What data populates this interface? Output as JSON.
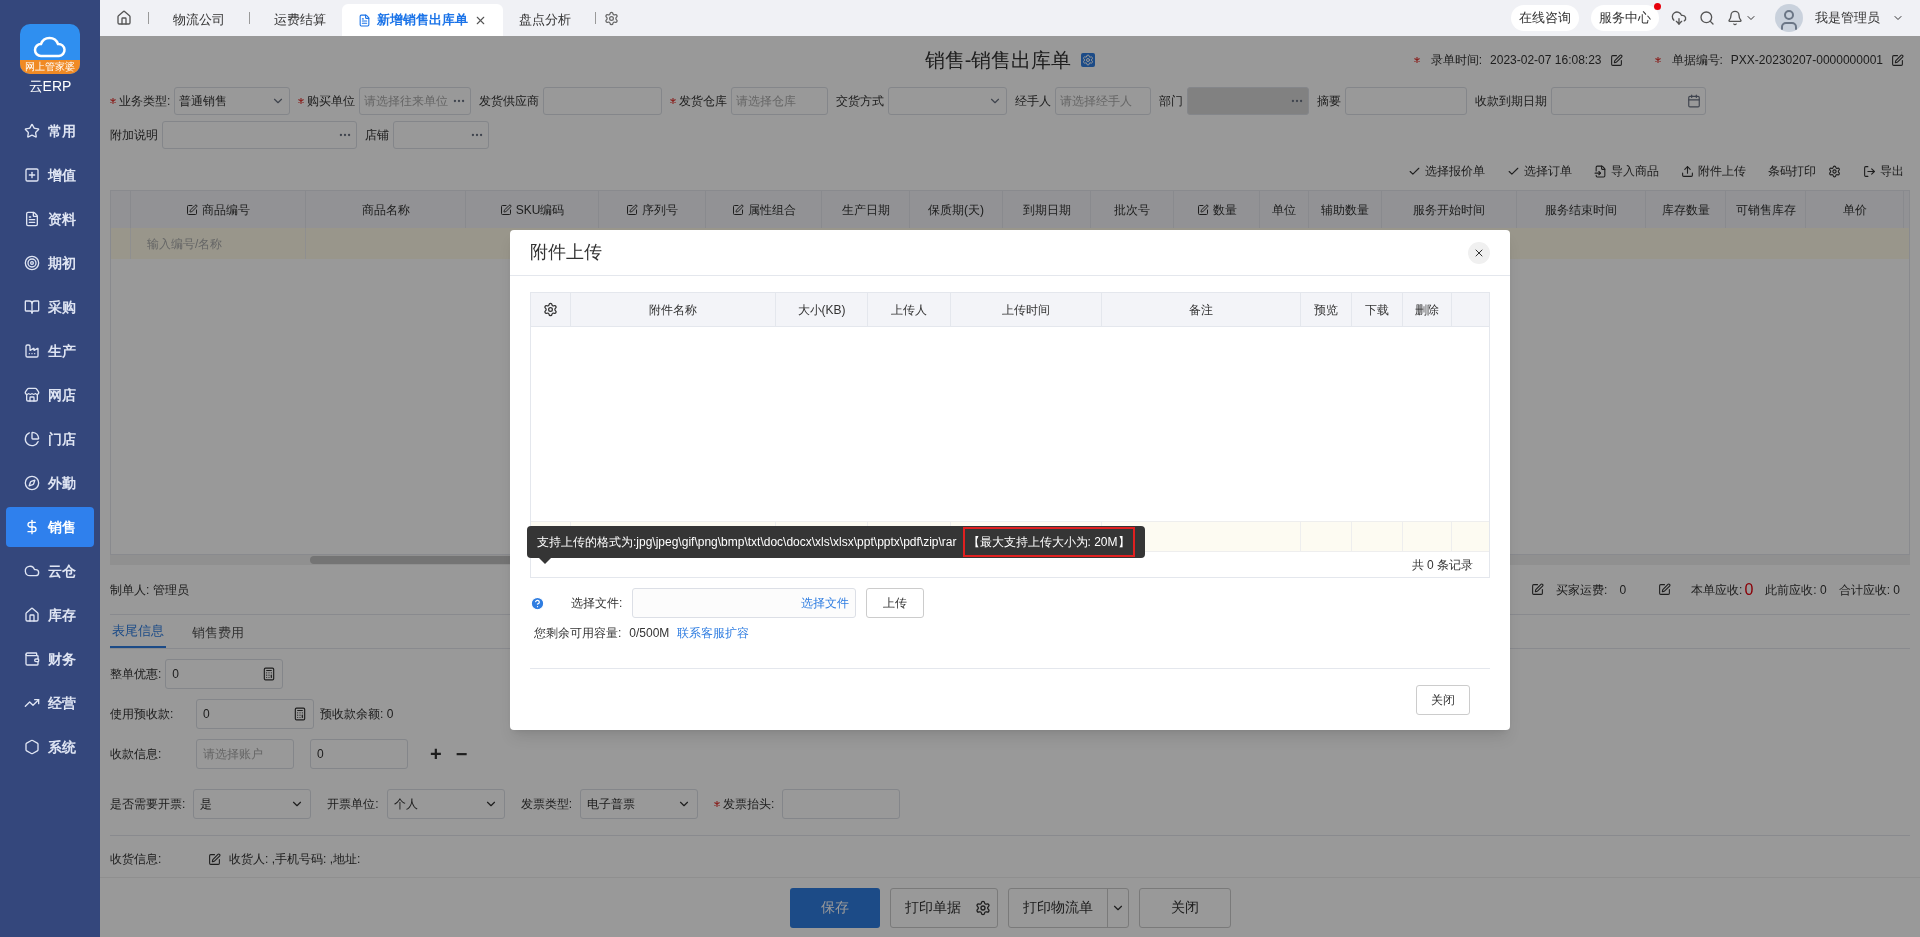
{
  "sidebar": {
    "logo_badge": "网上管家婆",
    "app_name": "云ERP",
    "items": [
      {
        "label": "常用",
        "selected": false
      },
      {
        "label": "增值",
        "selected": false
      },
      {
        "label": "资料",
        "selected": false
      },
      {
        "label": "期初",
        "selected": false
      },
      {
        "label": "采购",
        "selected": false
      },
      {
        "label": "生产",
        "selected": false
      },
      {
        "label": "网店",
        "selected": false
      },
      {
        "label": "门店",
        "selected": false
      },
      {
        "label": "外勤",
        "selected": false
      },
      {
        "label": "销售",
        "selected": true
      },
      {
        "label": "云仓",
        "selected": false
      },
      {
        "label": "库存",
        "selected": false
      },
      {
        "label": "财务",
        "selected": false
      },
      {
        "label": "经营",
        "selected": false
      },
      {
        "label": "系统",
        "selected": false
      }
    ]
  },
  "tabs": [
    {
      "label": "物流公司",
      "selected": false
    },
    {
      "label": "运费结算",
      "selected": false
    },
    {
      "label": "新增销售出库单",
      "selected": true
    },
    {
      "label": "盘点分析",
      "selected": false
    }
  ],
  "top_right": {
    "consult": "在线咨询",
    "service": "服务中心",
    "service_badge": true,
    "user": "我是管理员"
  },
  "form": {
    "title": "销售-销售出库单",
    "entry_time": {
      "label": "录单时间:",
      "required": true,
      "value": "2023-02-07 16:08:23"
    },
    "doc_no": {
      "label": "单据编号:",
      "required": true,
      "value": "PXX-20230207-0000000001"
    },
    "fields": [
      {
        "label": "业务类型:",
        "required": true,
        "value": "普通销售",
        "kind": "select",
        "disabled": false
      },
      {
        "label": "购买单位",
        "required": true,
        "placeholder": "请选择往来单位",
        "kind": "dots",
        "disabled": false
      },
      {
        "label": "发货供应商",
        "required": false,
        "kind": "text",
        "disabled": false
      },
      {
        "label": "发货仓库",
        "required": true,
        "placeholder": "请选择仓库",
        "kind": "text",
        "disabled": false
      },
      {
        "label": "交货方式",
        "required": false,
        "kind": "select",
        "disabled": false
      },
      {
        "label": "经手人",
        "required": false,
        "placeholder": "请选择经手人",
        "kind": "text",
        "disabled": false
      },
      {
        "label": "部门",
        "required": false,
        "kind": "dots",
        "disabled": true
      },
      {
        "label": "摘要",
        "required": false,
        "kind": "text",
        "disabled": false
      },
      {
        "label": "收款到期日期",
        "required": false,
        "kind": "date",
        "disabled": false
      }
    ],
    "fields_2": [
      {
        "label": "附加说明",
        "required": false,
        "kind": "dots",
        "disabled": false
      },
      {
        "label": "店铺",
        "required": false,
        "kind": "dots",
        "disabled": false
      }
    ]
  },
  "toolbar": [
    {
      "label": "选择报价单",
      "kind": "check"
    },
    {
      "label": "选择订单",
      "kind": "check"
    },
    {
      "label": "导入商品",
      "kind": "import"
    },
    {
      "label": "附件上传",
      "kind": "upload"
    },
    {
      "label": "条码打印",
      "kind": "gear"
    },
    {
      "label": "导出",
      "kind": "export"
    }
  ],
  "table": {
    "columns": [
      {
        "label": "商品编号",
        "icon": true
      },
      {
        "label": "商品名称",
        "icon": false
      },
      {
        "label": "SKU编码",
        "icon": true
      },
      {
        "label": "序列号",
        "icon": true
      },
      {
        "label": "属性组合",
        "icon": true
      },
      {
        "label": "生产日期",
        "icon": false
      },
      {
        "label": "保质期(天)",
        "icon": false
      },
      {
        "label": "到期日期",
        "icon": false
      },
      {
        "label": "批次号",
        "icon": false
      },
      {
        "label": "数量",
        "icon": true
      },
      {
        "label": "单位",
        "icon": false
      },
      {
        "label": "辅助数量",
        "icon": false
      },
      {
        "label": "服务开始时间",
        "icon": false
      },
      {
        "label": "服务结束时间",
        "icon": false
      },
      {
        "label": "库存数量",
        "icon": false
      },
      {
        "label": "可销售库存",
        "icon": false
      },
      {
        "label": "单价",
        "icon": false
      }
    ],
    "entry_placeholder": "输入编号/名称"
  },
  "summary": {
    "maker": "制单人: 管理员",
    "freight_label": "买家运费:",
    "freight": "0",
    "receivable_label": "本单应收:",
    "receivable": "0",
    "previous": "此前应收: 0",
    "total": "合计应收: 0"
  },
  "footer_tabs": [
    {
      "label": "表尾信息",
      "selected": true
    },
    {
      "label": "销售费用",
      "selected": false
    }
  ],
  "footer_form": {
    "discount_label": "整单优惠:",
    "discount": "0",
    "prepay_label": "使用预收款:",
    "prepay": "0",
    "prepay_balance": "预收款余额: 0",
    "payment_label": "收款信息:",
    "account_placeholder": "请选择账户",
    "payment_amount": "0",
    "plus": "+",
    "minus": "−",
    "invoice": [
      {
        "label": "是否需要开票:",
        "required": false,
        "value": "是",
        "kind": "select"
      },
      {
        "label": "开票单位:",
        "required": false,
        "value": "个人",
        "kind": "select"
      },
      {
        "label": "发票类型:",
        "required": false,
        "value": "电子普票",
        "kind": "select"
      },
      {
        "label": "发票抬头:",
        "required": true,
        "kind": "text"
      }
    ],
    "delivery_label": "收货信息:",
    "delivery": "收货人: ,手机号码: ,地址:"
  },
  "buttons": [
    {
      "label": "保存",
      "kind": "primary"
    },
    {
      "label": "打印单据",
      "kind": "gear"
    },
    {
      "label": "打印物流单",
      "kind": "caret"
    },
    {
      "label": "关闭",
      "kind": "plain"
    }
  ],
  "modal": {
    "title": "附件上传",
    "columns": [
      "附件名称",
      "大小(KB)",
      "上传人",
      "上传时间",
      "备注",
      "预览",
      "下载",
      "删除"
    ],
    "record_count": "共 0 条记录",
    "tooltip": {
      "text": "支持上传的格式为:jpg\\jpeg\\gif\\png\\bmp\\txt\\doc\\docx\\xls\\xlsx\\ppt\\pptx\\pdf\\zip\\rar",
      "note": "【最大支持上传大小为: 20M】",
      "note_highlighted": true
    },
    "file_label": "选择文件:",
    "file_link": "选择文件",
    "upload_button": "上传",
    "capacity_label": "您剩余可用容量:",
    "capacity": "0/500M",
    "expand_link": "联系客服扩容",
    "close_button": "关闭"
  }
}
